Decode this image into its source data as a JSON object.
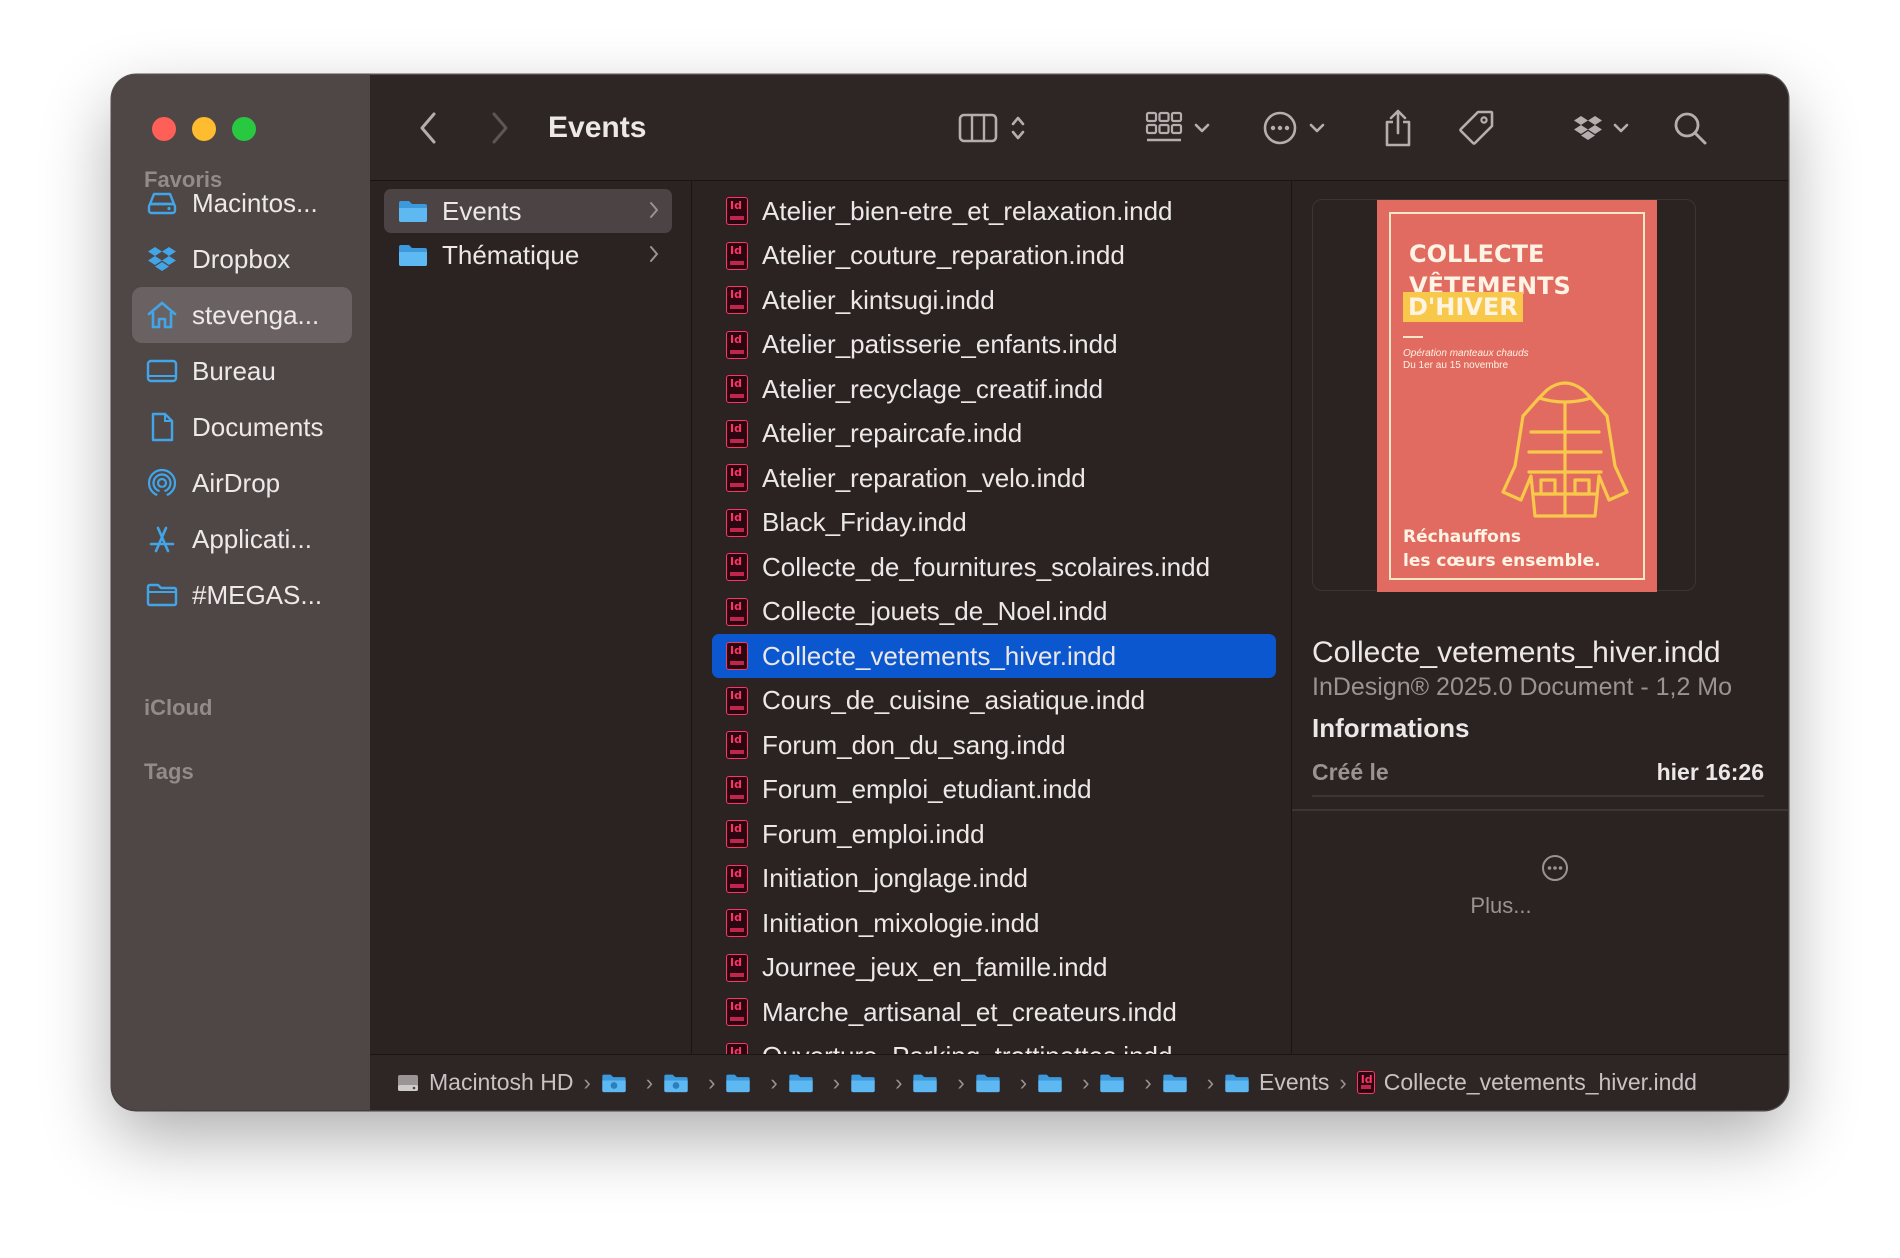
{
  "window": {
    "title": "Events"
  },
  "colors": {
    "accent": "#0b57d0",
    "folder": "#41a5e8",
    "indesign": "#ff3465",
    "poster_bg": "#e26b61"
  },
  "sidebar": {
    "favorites_label": "Favoris",
    "items": [
      {
        "label": "Macintos...",
        "icon": "drive-icon"
      },
      {
        "label": "Dropbox",
        "icon": "dropbox-icon"
      },
      {
        "label": "stevenga...",
        "icon": "home-icon",
        "active": true
      },
      {
        "label": "Bureau",
        "icon": "desktop-icon"
      },
      {
        "label": "Documents",
        "icon": "document-icon"
      },
      {
        "label": "AirDrop",
        "icon": "airdrop-icon"
      },
      {
        "label": "Applicati...",
        "icon": "applications-icon"
      },
      {
        "label": "#MEGAS...",
        "icon": "folder-icon"
      }
    ],
    "icloud_label": "iCloud",
    "tags_label": "Tags"
  },
  "columns": {
    "folders": [
      {
        "label": "Events",
        "selected": true
      },
      {
        "label": "Thématique",
        "selected": false
      }
    ],
    "files": [
      "Atelier_bien-etre_et_relaxation.indd",
      "Atelier_couture_reparation.indd",
      "Atelier_kintsugi.indd",
      "Atelier_patisserie_enfants.indd",
      "Atelier_recyclage_creatif.indd",
      "Atelier_repaircafe.indd",
      "Atelier_reparation_velo.indd",
      "Black_Friday.indd",
      "Collecte_de_fournitures_scolaires.indd",
      "Collecte_jouets_de_Noel.indd",
      "Collecte_vetements_hiver.indd",
      "Cours_de_cuisine_asiatique.indd",
      "Forum_don_du_sang.indd",
      "Forum_emploi_etudiant.indd",
      "Forum_emploi.indd",
      "Initiation_jonglage.indd",
      "Initiation_mixologie.indd",
      "Journee_jeux_en_famille.indd",
      "Marche_artisanal_et_createurs.indd",
      "Ouverture_Parking_trottinettes.indd"
    ],
    "selected_file": "Collecte_vetements_hiver.indd"
  },
  "preview": {
    "poster": {
      "title_line1": "COLLECTE",
      "title_line2": "VÊTEMENTS",
      "title_highlight": "D'HIVER",
      "subtitle": "Opération manteaux chauds",
      "dates": "Du 1er au 15 novembre",
      "slogan_line1": "Réchauffons",
      "slogan_line2": "les cœurs ensemble."
    },
    "name": "Collecte_vetements_hiver.indd",
    "kind": "InDesign® 2025.0 Document - 1,2 Mo",
    "info_heading": "Informations",
    "created_label": "Créé le",
    "created_value": "hier 16:26",
    "more_label": "Plus..."
  },
  "pathbar": {
    "root": "Macintosh HD",
    "events": "Events",
    "file": "Collecte_vetements_hiver.indd"
  }
}
